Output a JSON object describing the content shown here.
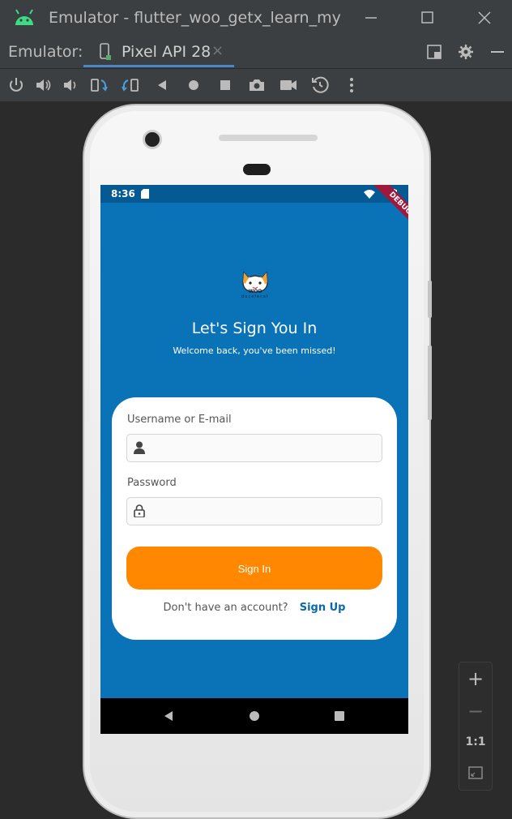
{
  "window": {
    "title": "Emulator - flutter_woo_getx_learn_my",
    "minimize_icon": "minimize-icon",
    "maximize_icon": "maximize-icon",
    "close_icon": "close-icon"
  },
  "tabbar": {
    "label": "Emulator:",
    "active_tab": "Pixel API 28",
    "close_glyph": "×"
  },
  "toolbar": {
    "icons": [
      "power-icon",
      "volume-up-icon",
      "volume-down-icon",
      "rotate-left-icon",
      "rotate-right-icon",
      "back-icon",
      "home-icon",
      "overview-icon",
      "screenshot-icon",
      "record-icon",
      "snapshot-icon",
      "more-icon"
    ]
  },
  "status_bar": {
    "time": "8:36",
    "debug_banner": "DEBUG"
  },
  "app": {
    "logo_text_1": "WOO",
    "logo_text_2": "ducafecat",
    "heading": "Let's Sign You In",
    "subheading": "Welcome back, you've been missed!",
    "username_label": "Username or E-mail",
    "username_value": "",
    "password_label": "Password",
    "password_value": "",
    "signin_button": "Sign In",
    "no_account_text": "Don't have an account?",
    "signup_link": "Sign Up",
    "colors": {
      "background": "#0a73b8",
      "accent": "#ff8800",
      "link": "#0a6aa8",
      "card": "#ffffff"
    }
  },
  "zoom": {
    "zoom_in": "+",
    "zoom_out": "−",
    "actual_size": "1:1"
  }
}
